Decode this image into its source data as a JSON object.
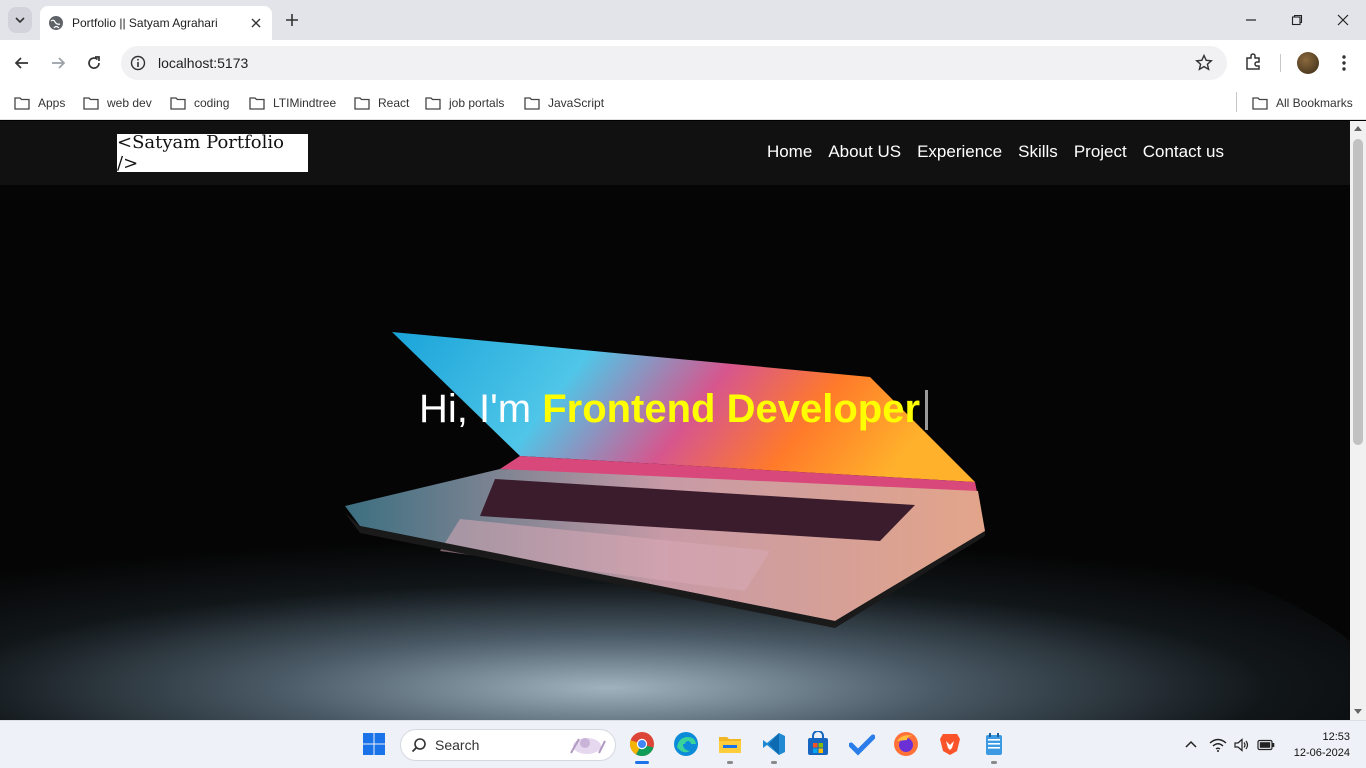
{
  "browser": {
    "tab": {
      "title": "Portfolio || Satyam Agrahari"
    },
    "address": {
      "url": "localhost:5173"
    },
    "bookmarks": [
      "Apps",
      "web dev",
      "coding",
      "LTIMindtree",
      "React",
      "job portals",
      "JavaScript"
    ],
    "all_bookmarks_label": "All Bookmarks"
  },
  "site": {
    "logo": "<Satyam Portfolio />",
    "nav": [
      "Home",
      "About US",
      "Experience",
      "Skills",
      "Project",
      "Contact us"
    ],
    "hero": {
      "greeting": "Hi, I'm ",
      "role": "Frontend Developer"
    }
  },
  "taskbar": {
    "search_label": "Search",
    "time": "12:53",
    "date": "12-06-2024"
  },
  "icons": {
    "tab_favicon": "globe-icon",
    "taskbar_apps": [
      "windows-start-icon",
      "chrome-icon",
      "edge-icon",
      "file-explorer-icon",
      "vscode-icon",
      "microsoft-store-icon",
      "todo-icon",
      "firefox-icon",
      "brave-icon",
      "notepad-icon"
    ]
  },
  "colors": {
    "accent_yellow": "#ffff00",
    "nav_background": "#121212",
    "logo_background": "#ffffff"
  }
}
